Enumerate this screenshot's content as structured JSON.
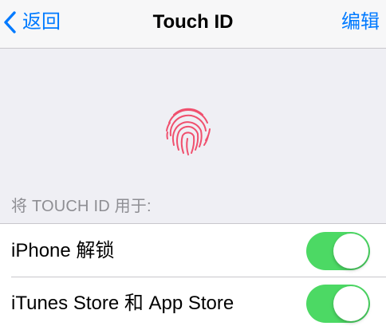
{
  "navbar": {
    "back_label": "返回",
    "title": "Touch ID",
    "edit_label": "编辑",
    "tint_color": "#007aff"
  },
  "fingerprint_icon": "fingerprint-icon",
  "fingerprint_color": "#f0506e",
  "section": {
    "header": "将 TOUCH ID 用于:",
    "rows": [
      {
        "label": "iPhone 解锁",
        "toggle_on": true
      },
      {
        "label": "iTunes Store 和 App Store",
        "toggle_on": true
      }
    ]
  },
  "toggle_on_color": "#4cd964"
}
